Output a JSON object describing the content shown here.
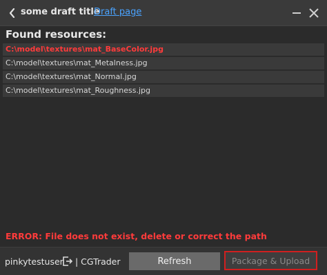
{
  "header": {
    "title": "some draft title",
    "link": "Draft page",
    "icons": {
      "back": "chevron-left-icon",
      "minimize": "minimize-icon",
      "close": "close-icon"
    }
  },
  "resources": {
    "heading": "Found resources:",
    "items": [
      {
        "path": "C:\\model\\textures\\mat_BaseColor.jpg",
        "status": "error"
      },
      {
        "path": "C:\\model\\textures\\mat_Metalness.jpg",
        "status": "ok"
      },
      {
        "path": "C:\\model\\textures\\mat_Normal.jpg",
        "status": "ok"
      },
      {
        "path": "C:\\model\\textures\\mat_Roughness.jpg",
        "status": "ok"
      }
    ]
  },
  "error": {
    "message": "ERROR: File does not exist, delete or correct the path"
  },
  "footer": {
    "username": "pinkytestuser",
    "platform": "| CGTrader",
    "refresh_label": "Refresh",
    "package_label": "Package & Upload",
    "logout_icon": "logout-icon"
  },
  "colors": {
    "background": "#2b2b2b",
    "error": "#ff3b3b",
    "link": "#4aa3ff",
    "highlight_border": "#d11f1f"
  }
}
